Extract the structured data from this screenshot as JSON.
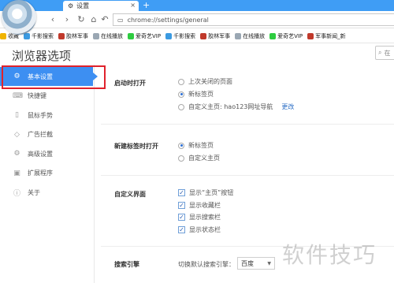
{
  "browser": {
    "tab": {
      "title": "设置",
      "close_glyph": "×"
    },
    "new_tab_glyph": "+",
    "address": "chrome://settings/general",
    "bookmarks": [
      {
        "label": "收藏",
        "icon": "star-icon",
        "color": "#f0b400"
      },
      {
        "label": "千影搜索",
        "icon": "search-icon",
        "color": "#3b9ae1"
      },
      {
        "label": "胶林军事",
        "icon": "site-icon",
        "color": "#c0392b"
      },
      {
        "label": "在线播放",
        "icon": "page-icon",
        "color": "#9aa7b3"
      },
      {
        "label": "爱奇艺VIP",
        "icon": "iqiyi-icon",
        "color": "#2ecc40"
      },
      {
        "label": "千影搜索",
        "icon": "search-icon",
        "color": "#3b9ae1"
      },
      {
        "label": "胶林军事",
        "icon": "site-icon",
        "color": "#c0392b"
      },
      {
        "label": "在线播放",
        "icon": "page-icon",
        "color": "#9aa7b3"
      },
      {
        "label": "爱奇艺VIP",
        "icon": "iqiyi-icon",
        "color": "#2ecc40"
      },
      {
        "label": "军事新闻_新",
        "icon": "site-icon",
        "color": "#c0392b"
      }
    ]
  },
  "settings": {
    "title": "浏览器选项",
    "search_placeholder": "在",
    "sidebar": [
      {
        "label": "基本设置",
        "icon": "gear-icon",
        "active": true
      },
      {
        "label": "快捷键",
        "icon": "keyboard-icon"
      },
      {
        "label": "鼠标手势",
        "icon": "mouse-icon"
      },
      {
        "label": "广告拦截",
        "icon": "shield-icon"
      },
      {
        "label": "高级设置",
        "icon": "gear-advanced-icon"
      },
      {
        "label": "扩展程序",
        "icon": "extension-icon"
      },
      {
        "label": "关于",
        "icon": "info-icon"
      }
    ],
    "startup": {
      "label": "启动时打开",
      "options": [
        "上次关闭的页面",
        "新标签页",
        "自定义主页: hao123网址导航"
      ],
      "selected": 1,
      "change_link": "更改"
    },
    "new_tab": {
      "label": "新建标签时打开",
      "options": [
        "新标签页",
        "自定义主页"
      ],
      "selected": 0
    },
    "custom_ui": {
      "label": "自定义界面",
      "options": [
        "显示“主页”按钮",
        "显示收藏栏",
        "显示搜索栏",
        "显示状态栏"
      ]
    },
    "search_engine": {
      "label": "搜索引擎",
      "prompt": "切换默认搜索引擎：",
      "value": "百度"
    }
  },
  "watermark": "软件技巧"
}
